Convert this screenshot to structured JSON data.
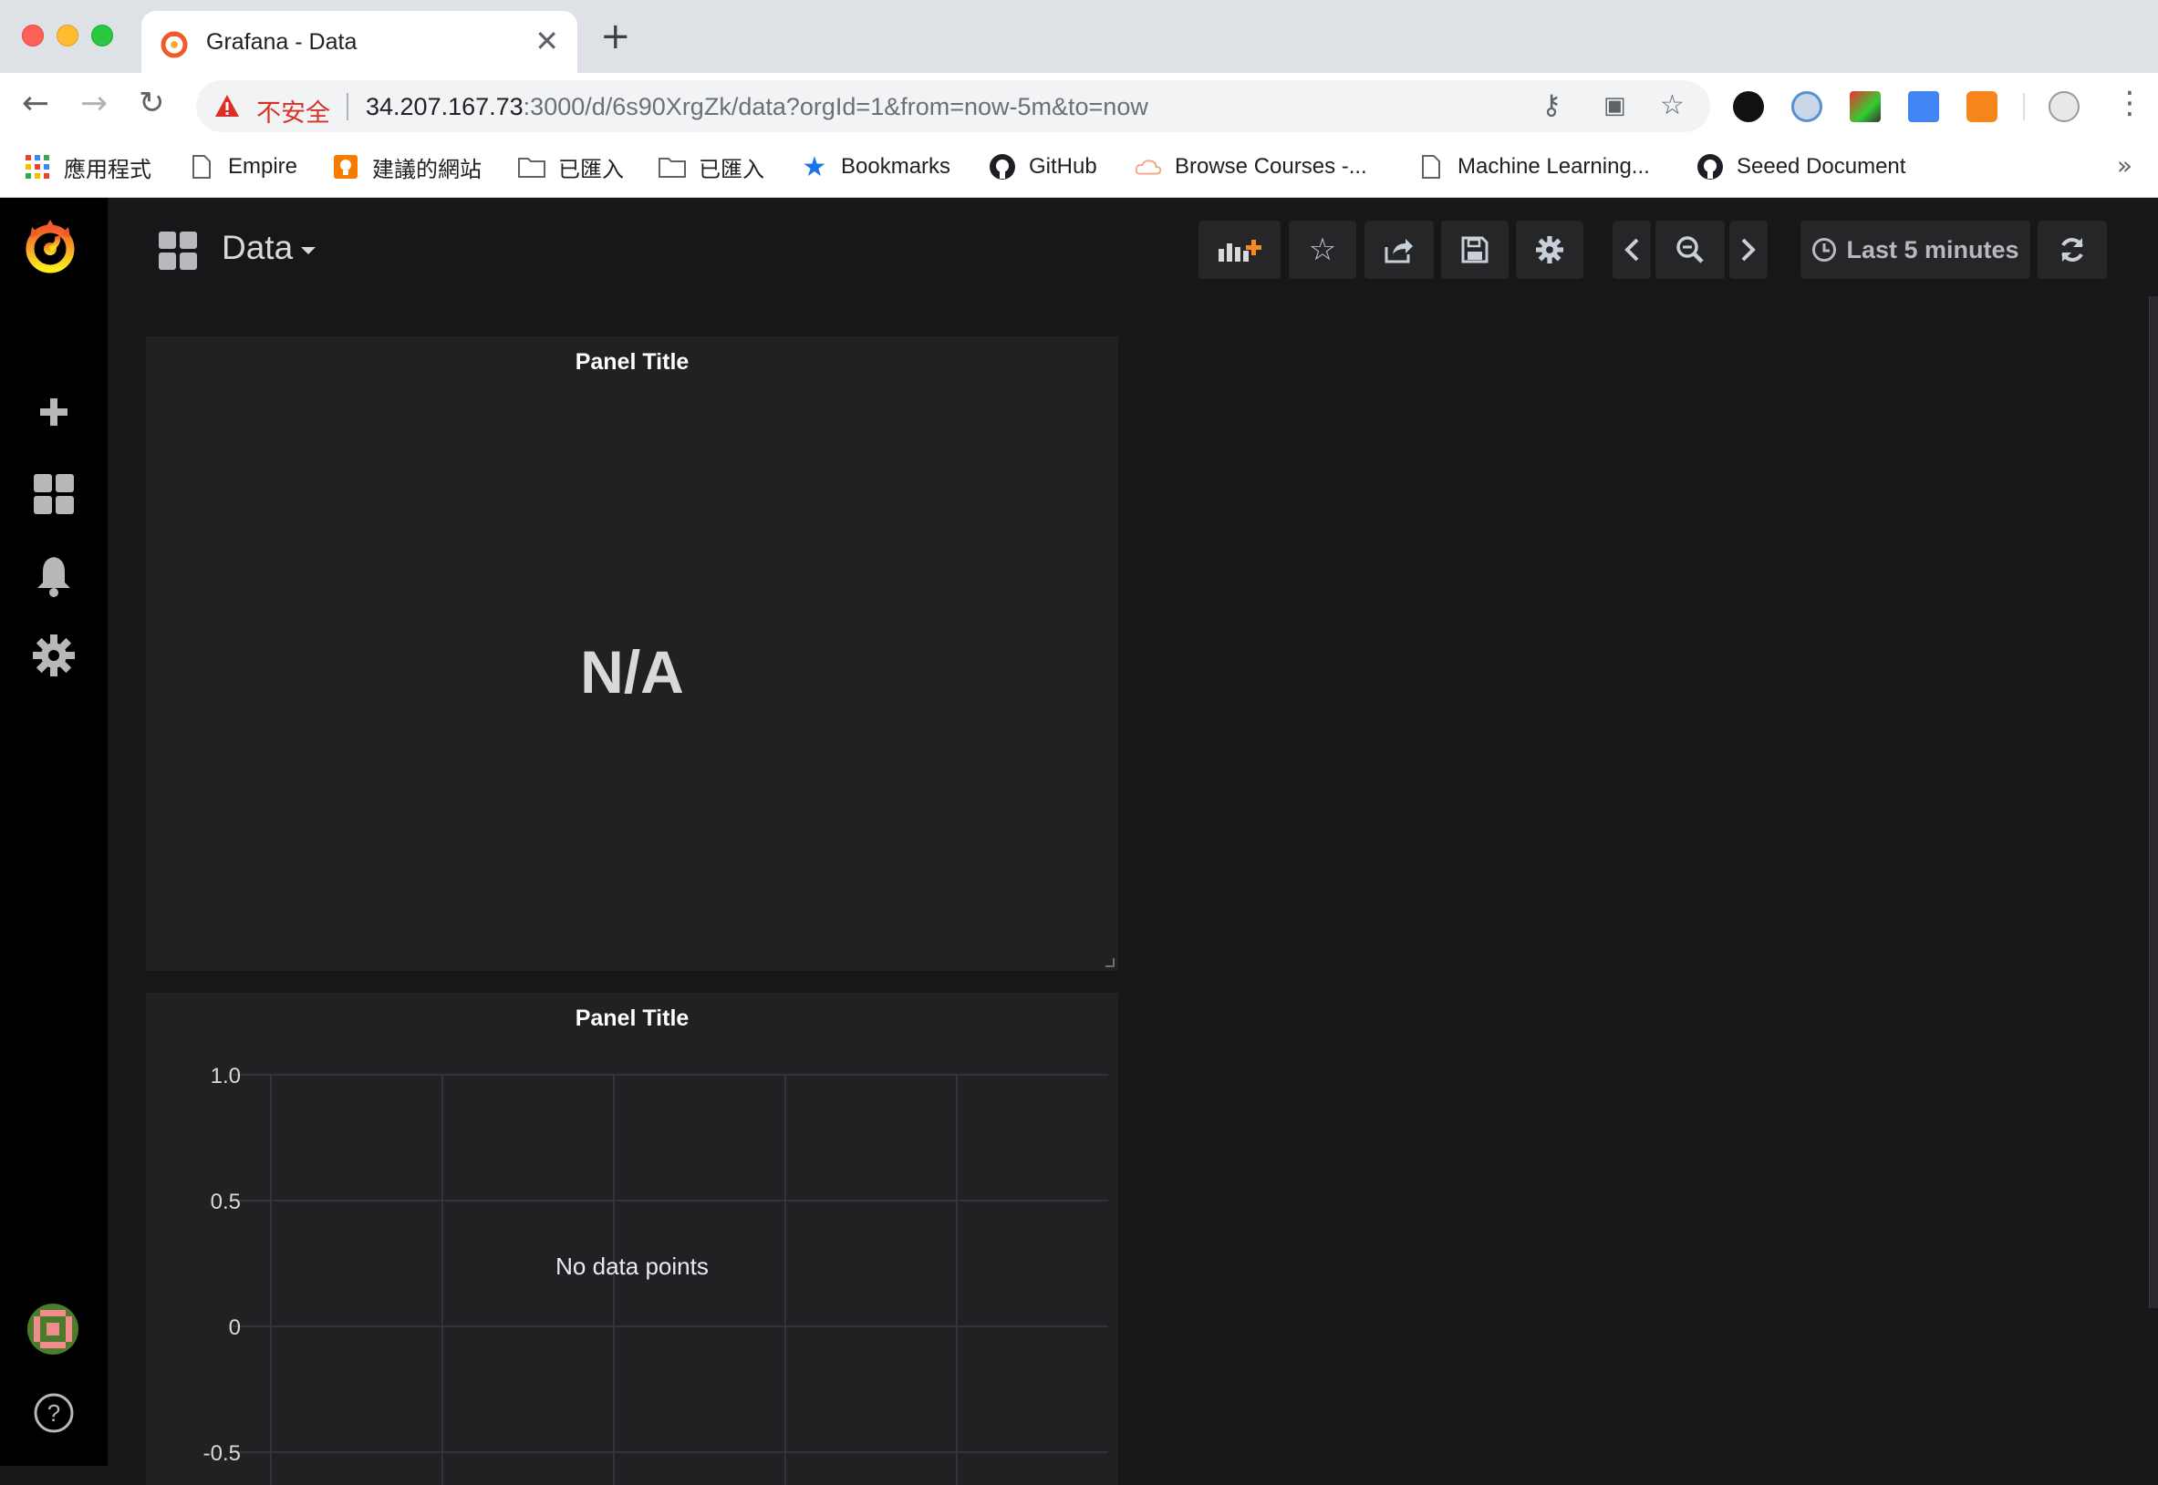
{
  "browser": {
    "tab_title": "Grafana - Data",
    "insecure_label": "不安全",
    "url_host": "34.207.167.73",
    "url_rest": ":3000/d/6s90XrgZk/data?orgId=1&from=now-5m&to=now",
    "bookmarks": [
      {
        "label": "應用程式",
        "icon": "apps-grid-icon"
      },
      {
        "label": "Empire",
        "icon": "page-icon"
      },
      {
        "label": "建議的網站",
        "icon": "bulb-icon"
      },
      {
        "label": "已匯入",
        "icon": "folder-icon"
      },
      {
        "label": "已匯入",
        "icon": "folder-icon"
      },
      {
        "label": "Bookmarks",
        "icon": "star-icon"
      },
      {
        "label": "GitHub",
        "icon": "github-icon"
      },
      {
        "label": "Browse Courses -...",
        "icon": "cloud-icon"
      },
      {
        "label": "Machine Learning...",
        "icon": "page-icon"
      },
      {
        "label": "Seeed Document",
        "icon": "github-icon"
      }
    ],
    "bookmarks_more": "»"
  },
  "dashboard": {
    "title": "Data",
    "time_range": "Last 5 minutes"
  },
  "panels": [
    {
      "title": "Panel Title",
      "value": "N/A"
    },
    {
      "title": "Panel Title",
      "no_data": "No data points"
    }
  ],
  "chart_data": {
    "type": "line",
    "title": "Panel Title",
    "series": [],
    "y_ticks": [
      "1.0",
      "0.5",
      "0",
      "-0.5"
    ],
    "ylim": [
      -0.5,
      1.0
    ],
    "grid": true,
    "annotation": "No data points"
  },
  "colors": {
    "grafana_orange": "#f05a28",
    "panel_bg": "#212124",
    "page_bg": "#161719"
  }
}
